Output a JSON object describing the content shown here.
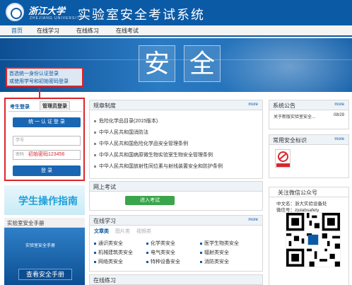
{
  "header": {
    "university_name": "浙江大学",
    "university_en": "ZHEJIANG UNIVERSITY",
    "system_title": "实验室安全考试系统"
  },
  "nav": {
    "items": [
      "首页",
      "在线学习",
      "在线练习",
      "在线考试"
    ],
    "active": "首页"
  },
  "banner": {
    "chars": [
      "安",
      "全"
    ]
  },
  "annotation_note": {
    "line1": "首选统一身份认证登录",
    "line2": "或使用学号和初始密码登录"
  },
  "login": {
    "tab_student": "考生登录",
    "tab_admin": "管理员登录",
    "unified_button": "统 一 认 证 登 录",
    "username_placeholder": "学号",
    "password_placeholder": "密码",
    "password_hint": "初始密码123456",
    "login_button": "登 录"
  },
  "guide": {
    "label": "学生操作指南"
  },
  "manual": {
    "header": "实验室安全手册",
    "cover_text": "实验室安全手册",
    "button": "查看安全手册"
  },
  "rules": {
    "title": "规章制度",
    "more": "more",
    "items": [
      "危险化学品目录(2015版本)",
      "中华人民共和国消防法",
      "中华人民共和国危险化学品安全管理条例",
      "中华人民共和国病原微生物实验室生物安全管理条例",
      "中华人民共和国放射性同位素与射线装置安全和防护条例"
    ]
  },
  "online_exam": {
    "title": "网上考试",
    "button": "进入考试"
  },
  "online_study": {
    "title": "在线学习",
    "more": "more",
    "sub_tabs": [
      "文章类",
      "图片类",
      "视频类"
    ],
    "categories": [
      [
        "通识类安全",
        "化学类安全",
        "医学生物类安全"
      ],
      [
        "机械建筑类安全",
        "电气类安全",
        "辐射类安全"
      ],
      [
        "网络类安全",
        "特种设备安全",
        "消防类安全"
      ]
    ]
  },
  "online_practice": {
    "title": "在线练习"
  },
  "announcements": {
    "title": "系统公告",
    "more": "more",
    "items": [
      {
        "text": "关于新版实验室安全...",
        "date": "08/29"
      }
    ]
  },
  "safety_signs": {
    "title": "常用安全标识",
    "more": "more",
    "sign_caption": "禁止吸烟"
  },
  "wechat": {
    "title": "关注微信公众号",
    "line1": "中文名：浙大实验设备处",
    "line2": "微信号：zjulabsafety"
  },
  "colors": {
    "brand_blue": "#0b5aa6",
    "highlight_red": "#d9262c",
    "button_green": "#3aa54a"
  }
}
